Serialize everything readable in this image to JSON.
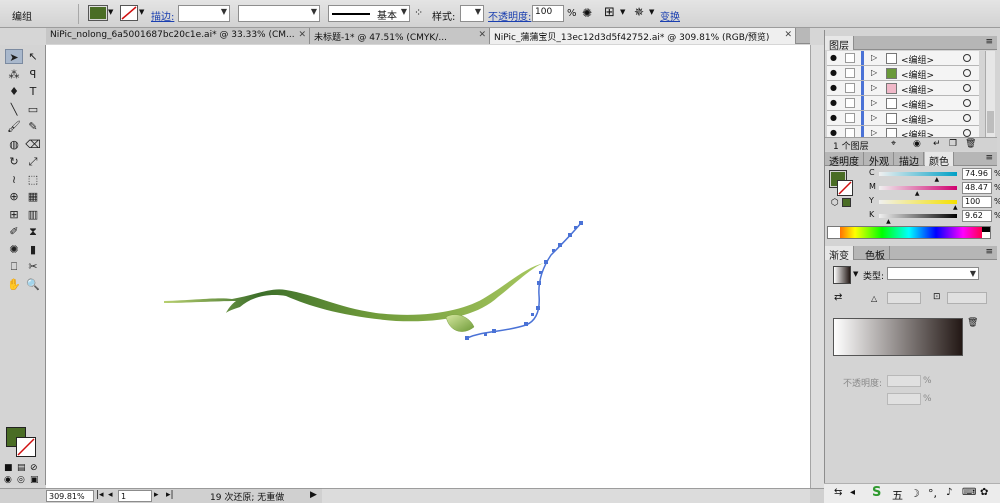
{
  "control_bar": {
    "selection_label": "编组",
    "fill_color": "#4a6d25",
    "stroke_label": "描边:",
    "stroke_style_label": "基本",
    "style_label": "样式:",
    "opacity_label": "不透明度:",
    "opacity_value": "100",
    "opacity_unit": "%",
    "transform_label": "变换"
  },
  "doc_tabs": [
    {
      "label": "NiPic_nolong_6a5001687bc20c1e.ai* @ 33.33% (CM...",
      "active": false
    },
    {
      "label": "未标题-1* @ 47.51% (CMYK/...",
      "active": false
    },
    {
      "label": "NiPic_蒲蒲宝贝_13ec12d3d5f42752.ai* @ 309.81% (RGB/预览)",
      "active": true
    }
  ],
  "tools": [
    "selection-tool",
    "direct-selection-tool",
    "magic-wand-tool",
    "lasso-tool",
    "pen-tool",
    "type-tool",
    "line-tool",
    "rectangle-tool",
    "paintbrush-tool",
    "pencil-tool",
    "blob-brush-tool",
    "eraser-tool",
    "rotate-tool",
    "scale-tool",
    "warp-tool",
    "free-transform-tool",
    "shape-builder-tool",
    "perspective-grid-tool",
    "mesh-tool",
    "gradient-tool",
    "eyedropper-tool",
    "blend-tool",
    "symbol-sprayer-tool",
    "column-graph-tool",
    "artboard-tool",
    "slice-tool",
    "hand-tool",
    "zoom-tool"
  ],
  "toolbox": {
    "fill_color": "#4a6d25"
  },
  "status_bar": {
    "zoom": "309.81%",
    "artboard": "1",
    "status_text": "19 次还原; 无重做"
  },
  "layers_panel": {
    "tab_label": "图层",
    "rows": [
      {
        "name": "<编组>",
        "thumb_color": "#ffffff"
      },
      {
        "name": "<编组>",
        "thumb_color": "#6a9a3a"
      },
      {
        "name": "<编组>",
        "thumb_color": "#f0b8c8"
      },
      {
        "name": "<编组>",
        "thumb_color": "#ffffff"
      },
      {
        "name": "<编组>",
        "thumb_color": "#ffffff"
      },
      {
        "name": "<编组>",
        "thumb_color": "#ffffff"
      }
    ],
    "footer_label": "1 个图层"
  },
  "color_panel": {
    "tabs": [
      "透明度",
      "外观",
      "描边",
      "颜色"
    ],
    "active_tab": "颜色",
    "channels": [
      {
        "label": "C",
        "value": "74.96",
        "color": "#00a0c6"
      },
      {
        "label": "M",
        "value": "48.47",
        "color": "#d0006f"
      },
      {
        "label": "Y",
        "value": "100",
        "color": "#f4e000"
      },
      {
        "label": "K",
        "value": "9.62",
        "color": "#000000"
      }
    ],
    "unit": "%",
    "fill_swatch": "#4a6d25"
  },
  "gradient_panel": {
    "tabs": [
      "渐变",
      "色板"
    ],
    "active_tab": "渐变",
    "type_label": "类型:",
    "opacity_label": "不透明度:",
    "unit": "%"
  }
}
